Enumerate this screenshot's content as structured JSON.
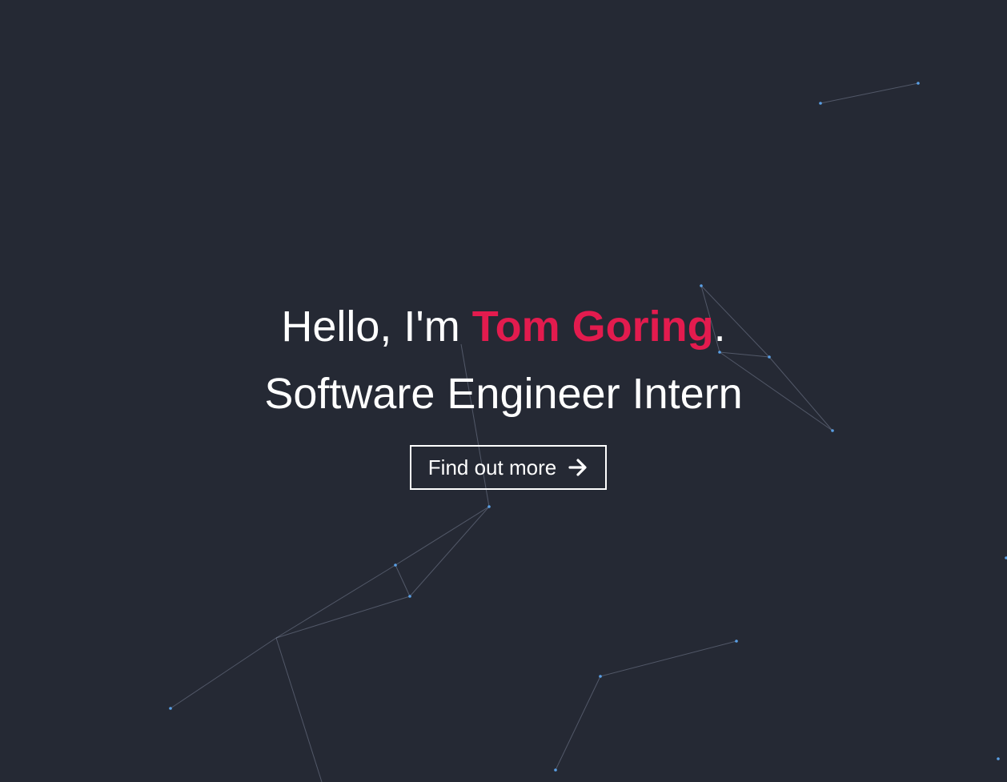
{
  "hero": {
    "greeting_prefix": "Hello, I'm ",
    "name": "Tom Goring",
    "greeting_suffix": ".",
    "role": "Software Engineer Intern",
    "cta_label": "Find out more",
    "cta_icon": "arrow-right-icon"
  },
  "colors": {
    "background": "#252934",
    "accent": "#e31b4e",
    "text": "#ffffff",
    "particle_dot": "#5aa0e6",
    "particle_line": "#8a93a8"
  }
}
